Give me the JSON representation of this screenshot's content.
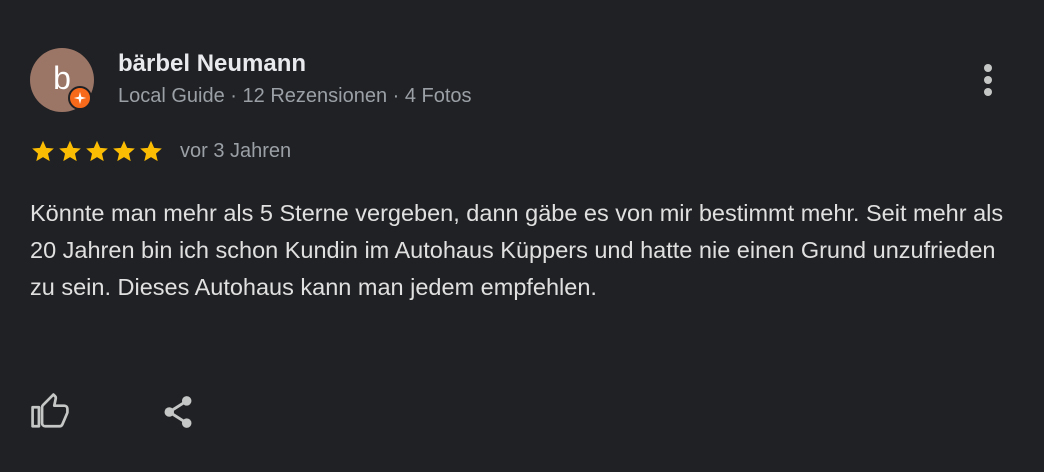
{
  "review": {
    "avatar_letter": "b",
    "avatar_color": "#9b7566",
    "badge_icon": "local-guide-badge-icon",
    "badge_color": "#f76a1b",
    "author_name": "bärbel Neumann",
    "author_meta": "Local Guide · 12 Rezensionen · 4 Fotos",
    "rating": 5,
    "max_rating": 5,
    "star_color": "#fbbc04",
    "date": "vor 3 Jahren",
    "text": "Könnte man mehr als 5 Sterne vergeben, dann gäbe es von mir bestimmt mehr. Seit mehr als 20 Jahren bin ich schon Kundin im Autohaus Küppers und hatte nie einen Grund unzufrieden zu sein. Dieses Autohaus kann man jedem empfehlen."
  },
  "actions": {
    "more_icon": "more-vert-icon",
    "like_icon": "thumbs-up-icon",
    "share_icon": "share-icon"
  }
}
